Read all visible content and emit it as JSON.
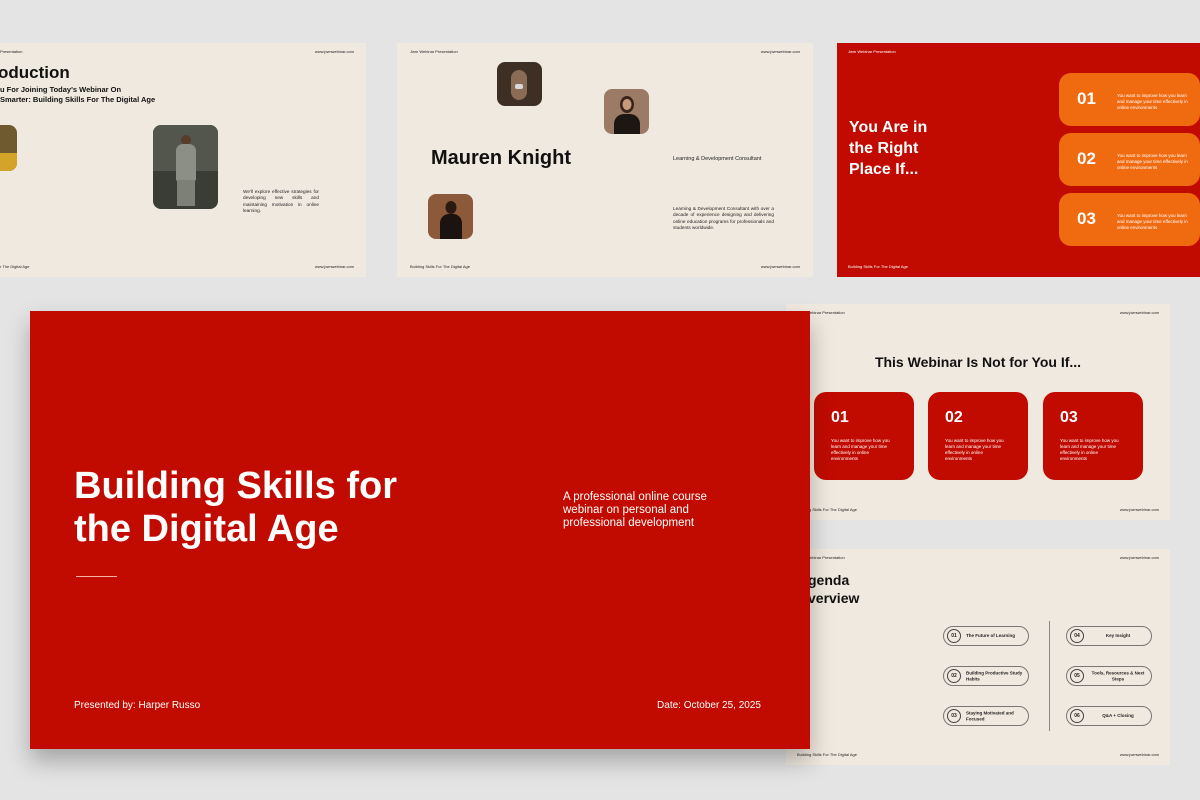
{
  "intro_slide": {
    "header_left": "Presentation",
    "header_right": "www.jwmwebinar.com",
    "title": "oduction",
    "subtitle_line1": "u For Joining Today's Webinar On",
    "subtitle_line2": "Smarter: Building Skills For The Digital Age",
    "description": "We'll explore effective strategies for developing new skills and maintaining motivation in online learning.",
    "footer_left": "r The Digital Age",
    "footer_right": "www.jwmwebinar.com"
  },
  "speaker_slide": {
    "header_left": "Jwm Webinar Presentation",
    "header_right": "www.jwmwebinar.com",
    "name": "Mauren Knight",
    "role": "Learning & Development Consultant",
    "bio": "Learning & Development Consultant with over a decade of experience designing and delivering online education programs for professionals and students worldwide.",
    "footer_left": "Building Skills For The Digital Age",
    "footer_right": "www.jwmwebinar.com"
  },
  "right_place_slide": {
    "header_left": "Jwm Webinar Presentation",
    "title_line1": "You Are in",
    "title_line2": "the Right",
    "title_line3": "Place If...",
    "items": [
      {
        "number": "01",
        "text": "You want to improve how you learn and manage your time effectively in online environments"
      },
      {
        "number": "02",
        "text": "You want to improve how you learn and manage your time effectively in online environments"
      },
      {
        "number": "03",
        "text": "You want to improve how you learn and manage your time effectively in online environments"
      }
    ],
    "footer_left": "Building Skills For The Digital Age"
  },
  "main_slide": {
    "title_line1": "Building Skills for",
    "title_line2": "the Digital Age",
    "description_line1": "A professional online course",
    "description_line2": "webinar on personal and",
    "description_line3": "professional development",
    "presenter": "Presented by: Harper Russo",
    "date": "Date: October 25, 2025"
  },
  "not_for_slide": {
    "header_left": "Jwm Webinar Presentation",
    "header_right": "www.jwmwebinar.com",
    "title": "This Webinar Is Not for You If...",
    "items": [
      {
        "number": "01",
        "text": "You want to improve how you learn and manage your time effectively in online environments"
      },
      {
        "number": "02",
        "text": "You want to improve how you learn and manage your time effectively in online environments"
      },
      {
        "number": "03",
        "text": "You want to improve how you learn and manage your time effectively in online environments"
      }
    ],
    "footer_left": "Building Skills For The Digital Age",
    "footer_right": "www.jwmwebinar.com"
  },
  "agenda_slide": {
    "header_left": "Jwm Webinar Presentation",
    "header_right": "www.jwmwebinar.com",
    "title_line1": "genda",
    "title_line2": "verview",
    "left_items": [
      {
        "number": "01",
        "text": "The Future of Learning"
      },
      {
        "number": "02",
        "text": "Building Productive Study Habits"
      },
      {
        "number": "03",
        "text": "Staying Motivated and Focused"
      }
    ],
    "right_items": [
      {
        "number": "04",
        "text": "Key Insight"
      },
      {
        "number": "05",
        "text": "Tools, Resources & Next Steps"
      },
      {
        "number": "06",
        "text": "Q&A + Closing"
      }
    ],
    "footer_left": "Building Skills For The Digital Age",
    "footer_right": "www.jwmwebinar.com"
  },
  "colors": {
    "red": "#c10b00",
    "orange": "#f06a10",
    "beige": "#f0e9df",
    "background": "#e4e4e4"
  }
}
